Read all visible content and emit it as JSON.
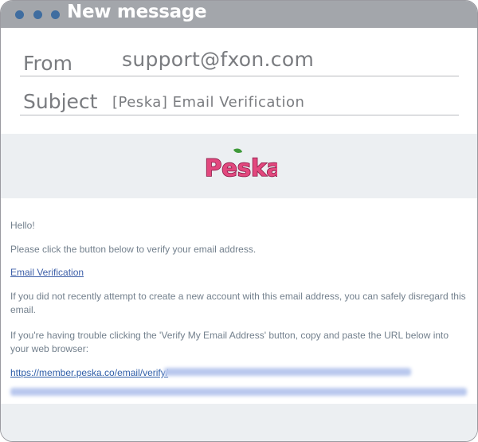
{
  "window": {
    "title": "New message"
  },
  "header": {
    "from_label": "From",
    "from_value": "support@fxon.com",
    "subject_label": "Subject",
    "subject_value": "[Peska] Email Verification"
  },
  "banner": {
    "logo_text": "Peska"
  },
  "email_body": {
    "greeting": "Hello!",
    "instruction": "Please click the button below to verify your email address.",
    "verify_link": "Email Verification",
    "disregard_note": "If you did not recently attempt to create a new account with this email address, you can safely disregard this email.",
    "trouble_note": "If you're having trouble clicking the 'Verify My Email Address' button, copy and paste the URL below into your web browser:",
    "url_prefix": "https://member.peska.co/email/verify/"
  },
  "colors": {
    "titlebar": "#a3a6ab",
    "dots": "#3f6da0",
    "banner_bg": "#eceff2",
    "link": "#3d5fa8",
    "logo_pink": "#e2487e"
  }
}
